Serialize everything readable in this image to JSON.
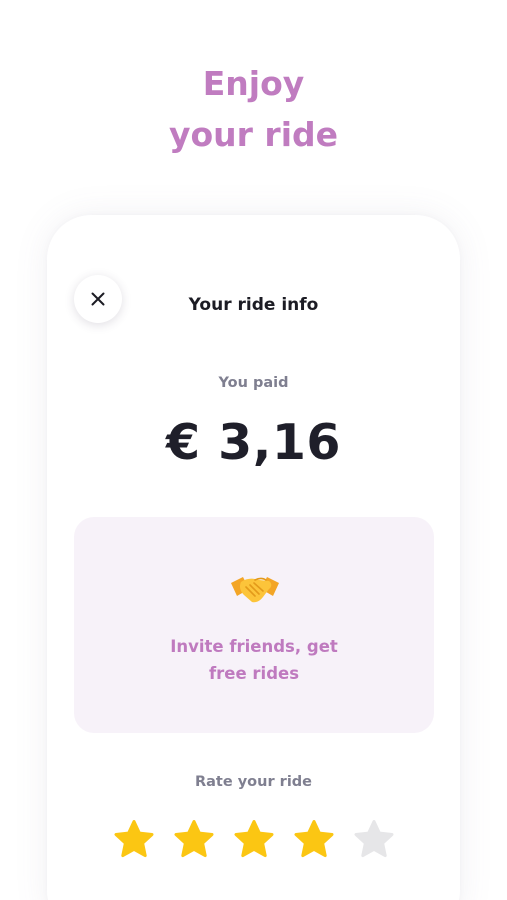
{
  "hero": {
    "line1": "Enjoy",
    "line2": "your ride"
  },
  "card": {
    "title": "Your ride info",
    "close_icon": "close-icon",
    "paid_label": "You paid",
    "amount": "€ 3,16"
  },
  "invite": {
    "icon": "handshake-icon",
    "line1": "Invite friends, get",
    "line2": "free rides"
  },
  "rating": {
    "label": "Rate your ride",
    "value": 4,
    "max": 5
  },
  "colors": {
    "accent": "#c07cc0",
    "invite_bg": "#f7f2f9",
    "star_filled": "#fbc613",
    "star_empty": "#e6e6e8",
    "text_dark": "#1f1f2a",
    "text_muted": "#7f7f90"
  }
}
